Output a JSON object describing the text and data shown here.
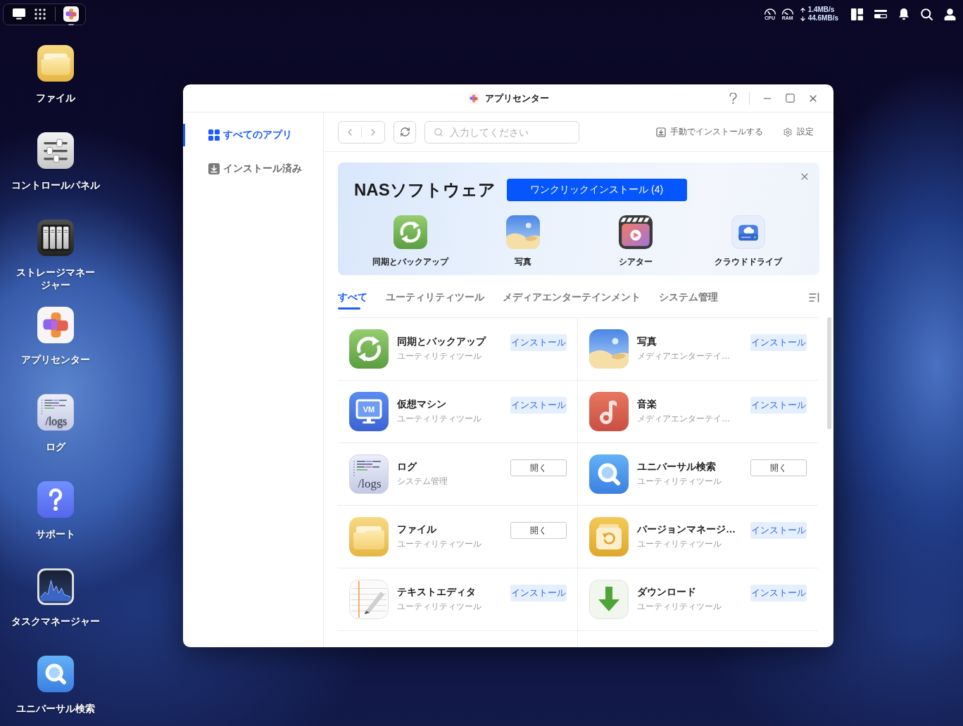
{
  "taskbar": {
    "apps": [
      {
        "kind": "app-center",
        "running": true
      }
    ]
  },
  "system_status": {
    "cpu_label": "CPU",
    "ram_label": "RAM",
    "upload": "1.4MB/s",
    "download": "44.6MB/s"
  },
  "desktop_icons": [
    {
      "kind": "files",
      "label": "ファイル"
    },
    {
      "kind": "control-panel",
      "label": "コントロールパネル"
    },
    {
      "kind": "storage",
      "label": "ストレージマネージャー"
    },
    {
      "kind": "app-center",
      "label": "アプリセンター"
    },
    {
      "kind": "logs",
      "label": "ログ",
      "icon_text": "/logs"
    },
    {
      "kind": "support",
      "label": "サポート"
    },
    {
      "kind": "task-manager",
      "label": "タスクマネージャー"
    },
    {
      "kind": "search",
      "label": "ユニバーサル検索"
    }
  ],
  "window": {
    "title": "アプリセンター"
  },
  "sidebar": {
    "items": [
      {
        "kind": "all-apps",
        "label": "すべてのアプリ",
        "selected": true
      },
      {
        "kind": "installed",
        "label": "インストール済み",
        "selected": false
      }
    ]
  },
  "toolbar": {
    "search": {
      "placeholder": "入力してください"
    },
    "actions": [
      {
        "kind": "manual-install",
        "label": "手動でインストールする"
      },
      {
        "kind": "settings",
        "label": "設定"
      }
    ]
  },
  "banner": {
    "title": "NASソフトウェア",
    "button": "ワンクリックインストール (4)",
    "apps": [
      {
        "kind": "sync",
        "name": "同期とバックアップ"
      },
      {
        "kind": "photos",
        "name": "写真"
      },
      {
        "kind": "theater",
        "name": "シアター"
      },
      {
        "kind": "cloud-drive",
        "name": "クラウドドライブ"
      }
    ]
  },
  "category_tabs": [
    {
      "label": "すべて",
      "selected": true
    },
    {
      "label": "ユーティリティツール",
      "selected": false
    },
    {
      "label": "メディアエンターテインメント",
      "selected": false
    },
    {
      "label": "システム管理",
      "selected": false
    }
  ],
  "apps": [
    {
      "kind": "sync",
      "name": "同期とバックアップ",
      "category": "ユーティリティツール",
      "action": {
        "kind": "install",
        "label": "インストール"
      }
    },
    {
      "kind": "photos",
      "name": "写真",
      "category": "メディアエンターテイ…",
      "action": {
        "kind": "install",
        "label": "インストール"
      }
    },
    {
      "kind": "vm",
      "name": "仮想マシン",
      "category": "ユーティリティツール",
      "icon_text": "VM",
      "action": {
        "kind": "install",
        "label": "インストール"
      }
    },
    {
      "kind": "music",
      "name": "音楽",
      "category": "メディアエンターテイ…",
      "action": {
        "kind": "install",
        "label": "インストール"
      }
    },
    {
      "kind": "logs",
      "name": "ログ",
      "category": "システム管理",
      "icon_text": "/logs",
      "action": {
        "kind": "open",
        "label": "開く"
      }
    },
    {
      "kind": "search",
      "name": "ユニバーサル検索",
      "category": "ユーティリティツール",
      "action": {
        "kind": "open",
        "label": "開く"
      }
    },
    {
      "kind": "files",
      "name": "ファイル",
      "category": "ユーティリティツール",
      "action": {
        "kind": "open",
        "label": "開く"
      }
    },
    {
      "kind": "version",
      "name": "バージョンマネージ…",
      "category": "ユーティリティツール",
      "action": {
        "kind": "install",
        "label": "インストール"
      }
    },
    {
      "kind": "text-editor",
      "name": "テキストエディタ",
      "category": "ユーティリティツール",
      "action": {
        "kind": "install",
        "label": "インストール"
      }
    },
    {
      "kind": "download",
      "name": "ダウンロード",
      "category": "ユーティリティツール",
      "action": {
        "kind": "install",
        "label": "インストール"
      }
    }
  ]
}
